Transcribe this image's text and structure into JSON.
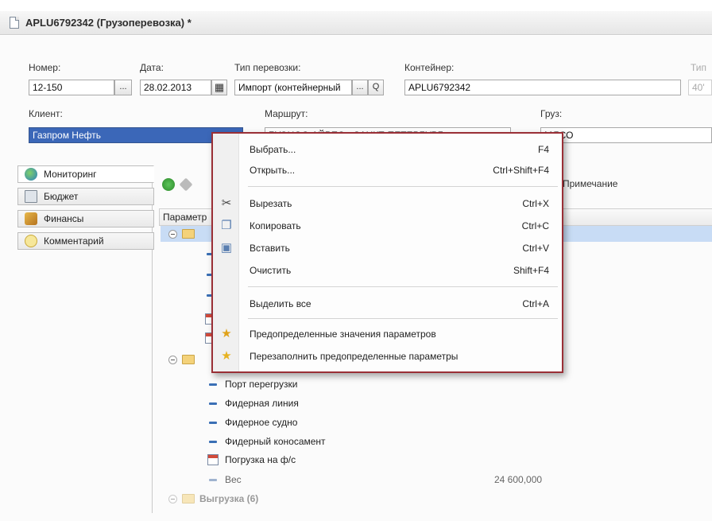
{
  "window": {
    "title": "APLU6792342 (Грузоперевозка) *"
  },
  "form": {
    "number_label": "Номер:",
    "number_value": "12-150",
    "date_label": "Дата:",
    "date_value": "28.02.2013",
    "transport_type_label": "Тип перевозки:",
    "transport_type_value": "Импорт (контейнерный",
    "container_label": "Контейнер:",
    "container_value": "APLU6792342",
    "container_type_label": "Тип",
    "container_type_value": "40'",
    "client_label": "Клиент:",
    "client_value": "Газпром Нефть",
    "route_label": "Маршрут:",
    "route_value": "БУЭНОС-АЙРЕС - САНКТ-ПЕТЕРБУРГ",
    "cargo_label": "Груз:",
    "cargo_value": "МЯСО",
    "ellipsis": "...",
    "search_glyph": "Q"
  },
  "tabs": [
    {
      "label": "Мониторинг",
      "icon": "globe-icon"
    },
    {
      "label": "Бюджет",
      "icon": "calculator-icon"
    },
    {
      "label": "Финансы",
      "icon": "finance-icon"
    },
    {
      "label": "Комментарий",
      "icon": "comment-icon"
    }
  ],
  "tree": {
    "header_param": "Параметр",
    "header_note": "Примечание",
    "rows": [
      {
        "label": "Порт перегрузки"
      },
      {
        "label": "Фидерная линия"
      },
      {
        "label": "Фидерное судно"
      },
      {
        "label": "Фидерный коносамент"
      },
      {
        "label": "Погрузка на ф/с"
      },
      {
        "label": "Вес",
        "value": "24 600,000"
      },
      {
        "label": "Выгрузка (6)"
      }
    ]
  },
  "context_menu": {
    "items": [
      {
        "label": "Выбрать...",
        "shortcut": "F4"
      },
      {
        "label": "Открыть...",
        "shortcut": "Ctrl+Shift+F4"
      },
      {
        "label": "Вырезать",
        "shortcut": "Ctrl+X",
        "icon": "scissors-icon"
      },
      {
        "label": "Копировать",
        "shortcut": "Ctrl+C",
        "icon": "copy-icon"
      },
      {
        "label": "Вставить",
        "shortcut": "Ctrl+V",
        "icon": "paste-icon"
      },
      {
        "label": "Очистить",
        "shortcut": "Shift+F4"
      },
      {
        "label": "Выделить все",
        "shortcut": "Ctrl+A"
      },
      {
        "label": "Предопределенные значения параметров",
        "shortcut": "",
        "icon": "star-wand-icon"
      },
      {
        "label": "Перезаполнить предопределенные параметры",
        "shortcut": "",
        "icon": "star-icon"
      }
    ]
  },
  "colors": {
    "menu_border": "#9a2f36",
    "selection": "#3b67b8",
    "row_highlight": "#c8dcf5"
  }
}
